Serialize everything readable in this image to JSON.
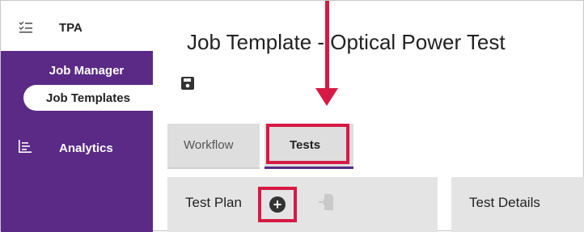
{
  "app": {
    "name": "TPA",
    "menu_icon": "checklist-icon"
  },
  "nav": {
    "section_label": "Job Manager",
    "items": [
      {
        "label": "Job Templates",
        "active": true
      },
      {
        "label": "Analytics",
        "icon": "bar-chart-icon"
      }
    ]
  },
  "page": {
    "title": "Job Template - Optical Power Test"
  },
  "toolbar": {
    "save_icon": "save-icon"
  },
  "tabs": [
    {
      "label": "Workflow",
      "active": false
    },
    {
      "label": "Tests",
      "active": true
    }
  ],
  "panels": {
    "test_plan": {
      "title": "Test Plan",
      "add_icon": "add-circle-icon",
      "import_icon": "import-file-icon"
    },
    "test_details": {
      "title": "Test Details"
    }
  },
  "colors": {
    "sidebar": "#5a2a86",
    "highlight": "#d61a45",
    "tab_bg": "#dedede",
    "panel_bg": "#e4e4e4"
  }
}
